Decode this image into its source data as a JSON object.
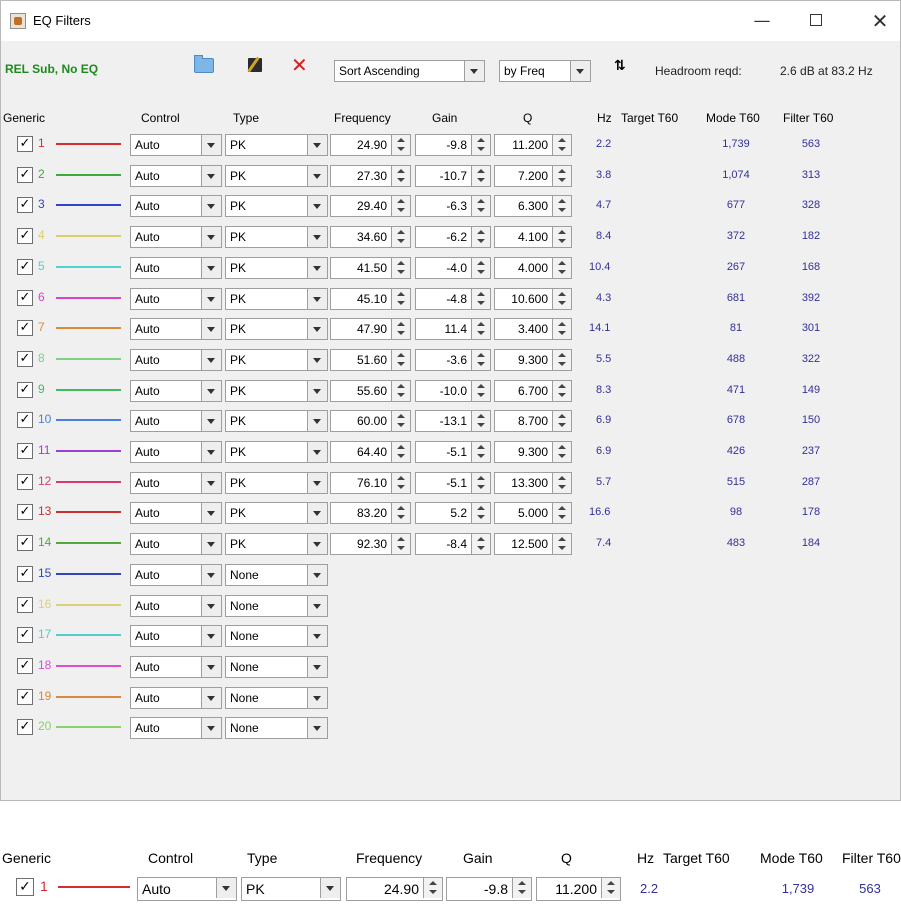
{
  "window": {
    "title": "EQ Filters"
  },
  "toolbar": {
    "config_label": "REL Sub, No EQ",
    "sort_order": "Sort Ascending",
    "sort_by": "by Freq",
    "headroom_label": "Headroom reqd:",
    "headroom_value": "2.6 dB at 83.2 Hz"
  },
  "columns": [
    "Generic",
    "Control",
    "Type",
    "Frequency",
    "Gain",
    "Q",
    "Hz",
    "Target T60",
    "Mode T60",
    "Filter T60"
  ],
  "filters": [
    {
      "num": "1",
      "color": "#d62c2c",
      "control": "Auto",
      "type": "PK",
      "frequency": "24.90",
      "gain": "-9.8",
      "q": "11.200",
      "hz": "2.2",
      "target_t60": "",
      "mode_t60": "1,739",
      "filter_t60": "563"
    },
    {
      "num": "2",
      "color": "#3caa3c",
      "control": "Auto",
      "type": "PK",
      "frequency": "27.30",
      "gain": "-10.7",
      "q": "7.200",
      "hz": "3.8",
      "target_t60": "",
      "mode_t60": "1,074",
      "filter_t60": "313"
    },
    {
      "num": "3",
      "color": "#3344cc",
      "control": "Auto",
      "type": "PK",
      "frequency": "29.40",
      "gain": "-6.3",
      "q": "6.300",
      "hz": "4.7",
      "target_t60": "",
      "mode_t60": "677",
      "filter_t60": "328"
    },
    {
      "num": "4",
      "color": "#d9cf6a",
      "control": "Auto",
      "type": "PK",
      "frequency": "34.60",
      "gain": "-6.2",
      "q": "4.100",
      "hz": "8.4",
      "target_t60": "",
      "mode_t60": "372",
      "filter_t60": "182"
    },
    {
      "num": "5",
      "color": "#52cfcf",
      "control": "Auto",
      "type": "PK",
      "frequency": "41.50",
      "gain": "-4.0",
      "q": "4.000",
      "hz": "10.4",
      "target_t60": "",
      "mode_t60": "267",
      "filter_t60": "168"
    },
    {
      "num": "6",
      "color": "#d845c8",
      "control": "Auto",
      "type": "PK",
      "frequency": "45.10",
      "gain": "-4.8",
      "q": "10.600",
      "hz": "4.3",
      "target_t60": "",
      "mode_t60": "681",
      "filter_t60": "392"
    },
    {
      "num": "7",
      "color": "#d98a3c",
      "control": "Auto",
      "type": "PK",
      "frequency": "47.90",
      "gain": "11.4",
      "q": "3.400",
      "hz": "14.1",
      "target_t60": "",
      "mode_t60": "81",
      "filter_t60": "301"
    },
    {
      "num": "8",
      "color": "#7fd17f",
      "control": "Auto",
      "type": "PK",
      "frequency": "51.60",
      "gain": "-3.6",
      "q": "9.300",
      "hz": "5.5",
      "target_t60": "",
      "mode_t60": "488",
      "filter_t60": "322"
    },
    {
      "num": "9",
      "color": "#44b95f",
      "control": "Auto",
      "type": "PK",
      "frequency": "55.60",
      "gain": "-10.0",
      "q": "6.700",
      "hz": "8.3",
      "target_t60": "",
      "mode_t60": "471",
      "filter_t60": "149"
    },
    {
      "num": "10",
      "color": "#4a7fd6",
      "control": "Auto",
      "type": "PK",
      "frequency": "60.00",
      "gain": "-13.1",
      "q": "8.700",
      "hz": "6.9",
      "target_t60": "",
      "mode_t60": "678",
      "filter_t60": "150"
    },
    {
      "num": "11",
      "color": "#9b3fd1",
      "control": "Auto",
      "type": "PK",
      "frequency": "64.40",
      "gain": "-5.1",
      "q": "9.300",
      "hz": "6.9",
      "target_t60": "",
      "mode_t60": "426",
      "filter_t60": "237"
    },
    {
      "num": "12",
      "color": "#d63c6a",
      "control": "Auto",
      "type": "PK",
      "frequency": "76.10",
      "gain": "-5.1",
      "q": "13.300",
      "hz": "5.7",
      "target_t60": "",
      "mode_t60": "515",
      "filter_t60": "287"
    },
    {
      "num": "13",
      "color": "#cc2f2f",
      "control": "Auto",
      "type": "PK",
      "frequency": "83.20",
      "gain": "5.2",
      "q": "5.000",
      "hz": "16.6",
      "target_t60": "",
      "mode_t60": "98",
      "filter_t60": "178"
    },
    {
      "num": "14",
      "color": "#52a83a",
      "control": "Auto",
      "type": "PK",
      "frequency": "92.30",
      "gain": "-8.4",
      "q": "12.500",
      "hz": "7.4",
      "target_t60": "",
      "mode_t60": "483",
      "filter_t60": "184"
    },
    {
      "num": "15",
      "color": "#3346b8",
      "control": "Auto",
      "type": "None"
    },
    {
      "num": "16",
      "color": "#dccf7a",
      "control": "Auto",
      "type": "None"
    },
    {
      "num": "17",
      "color": "#56cccc",
      "control": "Auto",
      "type": "None"
    },
    {
      "num": "18",
      "color": "#d84fd0",
      "control": "Auto",
      "type": "None"
    },
    {
      "num": "19",
      "color": "#d6893f",
      "control": "Auto",
      "type": "None"
    },
    {
      "num": "20",
      "color": "#84d46a",
      "control": "Auto",
      "type": "None"
    }
  ],
  "zoom_detail": {
    "columns": [
      "Generic",
      "Control",
      "Type",
      "Frequency",
      "Gain",
      "Q",
      "Hz",
      "Target T60",
      "Mode T60",
      "Filter T60"
    ],
    "row": {
      "num": "1",
      "color": "#d62c2c",
      "control": "Auto",
      "type": "PK",
      "frequency": "24.90",
      "gain": "-9.8",
      "q": "11.200",
      "hz": "2.2",
      "target_t60": "",
      "mode_t60": "1,739",
      "filter_t60": "563"
    }
  }
}
